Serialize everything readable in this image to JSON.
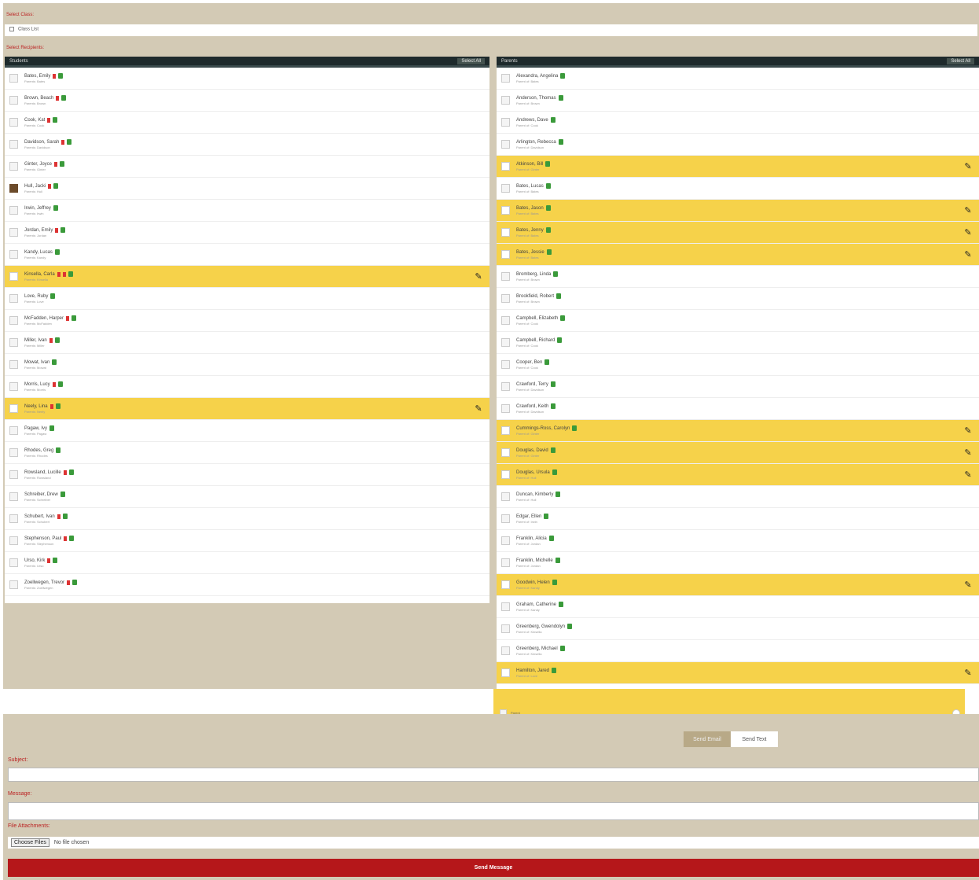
{
  "top": {
    "class_label": "Select Class:",
    "class_value": "Class List",
    "recipients_label": "Select Recipients:"
  },
  "left_panel": {
    "title": "Students",
    "select_all": "Select All",
    "rows": [
      {
        "name": "Bates, Emily",
        "sub": "Parents: Bates",
        "flags": [
          "red",
          "green"
        ],
        "hl": false
      },
      {
        "name": "Brown, Beach",
        "sub": "Parents: Brown",
        "flags": [
          "red",
          "green"
        ],
        "hl": false
      },
      {
        "name": "Cook, Kat",
        "sub": "Parents: Cook",
        "flags": [
          "red",
          "green"
        ],
        "hl": false
      },
      {
        "name": "Davidson, Sarah",
        "sub": "Parents: Davidson",
        "flags": [
          "red",
          "green"
        ],
        "hl": false
      },
      {
        "name": "Ginter, Joyce",
        "sub": "Parents: Ginter",
        "flags": [
          "red",
          "green"
        ],
        "hl": false
      },
      {
        "name": "Hull, Jacki",
        "sub": "Parents: Hull",
        "flags": [
          "red",
          "green"
        ],
        "hl": false,
        "photo": true
      },
      {
        "name": "Irwin, Jeffrey",
        "sub": "Parents: Irwin",
        "flags": [
          "green"
        ],
        "hl": false
      },
      {
        "name": "Jordan, Emily",
        "sub": "Parents: Jordan",
        "flags": [
          "red",
          "green"
        ],
        "hl": false
      },
      {
        "name": "Kandy, Lucas",
        "sub": "Parents: Kandy",
        "flags": [
          "green"
        ],
        "hl": false
      },
      {
        "name": "Kinsella, Carla",
        "sub": "Parents: Kinsella",
        "flags": [
          "red",
          "red",
          "green"
        ],
        "hl": true
      },
      {
        "name": "Love, Ruby",
        "sub": "Parents: Love",
        "flags": [
          "green"
        ],
        "hl": false
      },
      {
        "name": "McFadden, Harper",
        "sub": "Parents: McFadden",
        "flags": [
          "red",
          "green"
        ],
        "hl": false
      },
      {
        "name": "Miller, Ivan",
        "sub": "Parents: Miller",
        "flags": [
          "red",
          "green"
        ],
        "hl": false
      },
      {
        "name": "Mowat, Ivan",
        "sub": "Parents: Mowat",
        "flags": [
          "green"
        ],
        "hl": false
      },
      {
        "name": "Morris, Lucy",
        "sub": "Parents: Morris",
        "flags": [
          "red",
          "green"
        ],
        "hl": false
      },
      {
        "name": "Neely, Lina",
        "sub": "Parents: Neely",
        "flags": [
          "red",
          "green"
        ],
        "hl": true
      },
      {
        "name": "Pagaw, Ivy",
        "sub": "Parents: Pagaw",
        "flags": [
          "green"
        ],
        "hl": false
      },
      {
        "name": "Rhodes, Greg",
        "sub": "Parents: Rhodes",
        "flags": [
          "green"
        ],
        "hl": false
      },
      {
        "name": "Rowsland, Lucille",
        "sub": "Parents: Rowsland",
        "flags": [
          "red",
          "green"
        ],
        "hl": false
      },
      {
        "name": "Schreiber, Drew",
        "sub": "Parents: Schreiber",
        "flags": [
          "green"
        ],
        "hl": false
      },
      {
        "name": "Schubert, Ivan",
        "sub": "Parents: Schubert",
        "flags": [
          "red",
          "green"
        ],
        "hl": false
      },
      {
        "name": "Stephenson, Paul",
        "sub": "Parents: Stephenson",
        "flags": [
          "red",
          "green"
        ],
        "hl": false
      },
      {
        "name": "Urso, Kirk",
        "sub": "Parents: Urso",
        "flags": [
          "red",
          "green"
        ],
        "hl": false
      },
      {
        "name": "Zoellwegen, Trevor",
        "sub": "Parents: Zoellwegen",
        "flags": [
          "red",
          "green"
        ],
        "hl": false
      }
    ]
  },
  "right_panel": {
    "title": "Parents",
    "select_all": "Select All",
    "rows": [
      {
        "name": "Alexandra, Angelina",
        "sub": "Parent of: Bates",
        "hl": false
      },
      {
        "name": "Anderson, Thomas",
        "sub": "Parent of: Brown",
        "hl": false
      },
      {
        "name": "Andrews, Dave",
        "sub": "Parent of: Cook",
        "hl": false
      },
      {
        "name": "Arlington, Rebecca",
        "sub": "Parent of: Davidson",
        "hl": false
      },
      {
        "name": "Atkinson, Bill",
        "sub": "Parent of: Ginter",
        "hl": true
      },
      {
        "name": "Bates, Lucas",
        "sub": "Parent of: Bates",
        "hl": false
      },
      {
        "name": "Bates, Jason",
        "sub": "Parent of: Bates",
        "hl": true
      },
      {
        "name": "Bates, Jenny",
        "sub": "Parent of: Bates",
        "hl": true
      },
      {
        "name": "Bates, Jessie",
        "sub": "Parent of: Bates",
        "hl": true
      },
      {
        "name": "Bromberg, Linda",
        "sub": "Parent of: Brown",
        "hl": false
      },
      {
        "name": "Brookfield, Robert",
        "sub": "Parent of: Brown",
        "hl": false
      },
      {
        "name": "Campbell, Elizabeth",
        "sub": "Parent of: Cook",
        "hl": false
      },
      {
        "name": "Campbell, Richard",
        "sub": "Parent of: Cook",
        "hl": false
      },
      {
        "name": "Cooper, Ben",
        "sub": "Parent of: Cook",
        "hl": false
      },
      {
        "name": "Crawford, Terry",
        "sub": "Parent of: Davidson",
        "hl": false
      },
      {
        "name": "Crawford, Keith",
        "sub": "Parent of: Davidson",
        "hl": false
      },
      {
        "name": "Cummings-Ross, Carolyn",
        "sub": "Parent of: Ginter",
        "hl": true
      },
      {
        "name": "Douglas, David",
        "sub": "Parent of: Ginter",
        "hl": true
      },
      {
        "name": "Douglas, Ursula",
        "sub": "Parent of: Hull",
        "hl": true
      },
      {
        "name": "Duncan, Kimberly",
        "sub": "Parent of: Hull",
        "hl": false
      },
      {
        "name": "Edgar, Ellen",
        "sub": "Parent of: Irwin",
        "hl": false
      },
      {
        "name": "Franklin, Alicia",
        "sub": "Parent of: Jordan",
        "hl": false
      },
      {
        "name": "Franklin, Michelle",
        "sub": "Parent of: Jordan",
        "hl": false
      },
      {
        "name": "Goodwin, Helen",
        "sub": "Parent of: Kandy",
        "hl": true
      },
      {
        "name": "Graham, Catherine",
        "sub": "Parent of: Kandy",
        "hl": false
      },
      {
        "name": "Greenberg, Gwendolyn",
        "sub": "Parent of: Kinsella",
        "hl": false
      },
      {
        "name": "Greenberg, Michael",
        "sub": "Parent of: Kinsella",
        "hl": false
      },
      {
        "name": "Hamilton, Jared",
        "sub": "Parent of: Love",
        "hl": true
      }
    ],
    "tail_text": "Parent"
  },
  "compose": {
    "tab_email": "Send Email",
    "tab_text": "Send Text",
    "subject_label": "Subject:",
    "message_label": "Message:",
    "attachments_label": "File Attachments:",
    "choose_files": "Choose Files",
    "no_file": "No file chosen",
    "send_button": "Send Message"
  }
}
